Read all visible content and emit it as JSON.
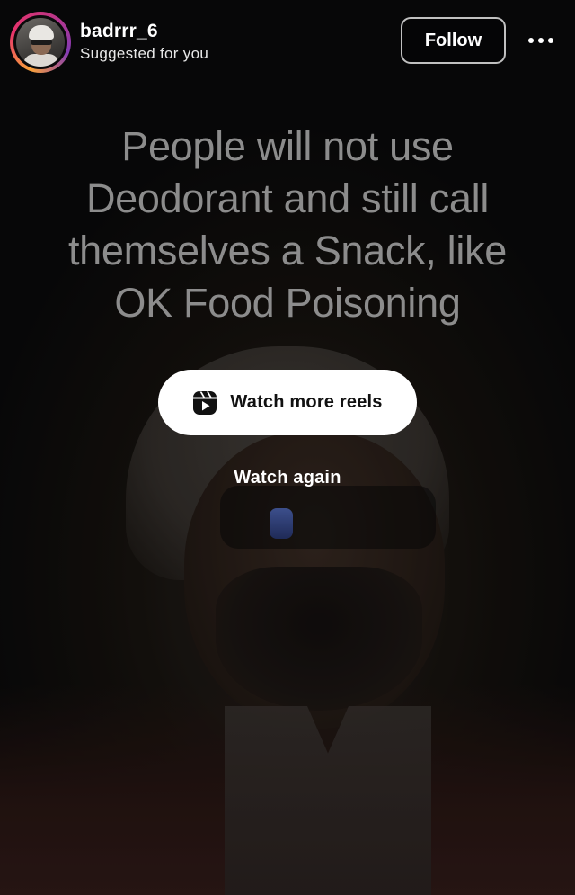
{
  "header": {
    "username": "badrrr_6",
    "subtitle": "Suggested for you",
    "follow_label": "Follow",
    "avatar_icon": "profile-photo",
    "more_icon": "more-horizontal-icon"
  },
  "caption": {
    "lines": [
      "People will not use",
      "Deodorant and still call",
      "themselves a Snack, like",
      "OK Food Poisoning"
    ]
  },
  "end_actions": {
    "watch_more_label": "Watch more reels",
    "watch_more_icon": "reels-icon",
    "watch_again_label": "Watch again"
  },
  "colors": {
    "background": "#0a0a0b",
    "caption_text": "#8c8c8c",
    "button_bg": "#ffffff",
    "story_ring": [
      "#f9a23a",
      "#e6336b",
      "#833ab4"
    ]
  }
}
